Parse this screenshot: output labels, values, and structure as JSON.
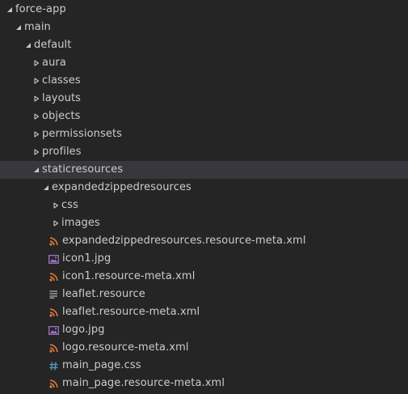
{
  "explorer": {
    "items": [
      {
        "name": "root-folder-force-app",
        "label": "force-app",
        "type": "folder",
        "expanded": true,
        "depth": 0
      },
      {
        "name": "folder-main",
        "label": "main",
        "type": "folder",
        "expanded": true,
        "depth": 1
      },
      {
        "name": "folder-default",
        "label": "default",
        "type": "folder",
        "expanded": true,
        "depth": 2
      },
      {
        "name": "folder-aura",
        "label": "aura",
        "type": "folder",
        "expanded": false,
        "depth": 3
      },
      {
        "name": "folder-classes",
        "label": "classes",
        "type": "folder",
        "expanded": false,
        "depth": 3
      },
      {
        "name": "folder-layouts",
        "label": "layouts",
        "type": "folder",
        "expanded": false,
        "depth": 3
      },
      {
        "name": "folder-objects",
        "label": "objects",
        "type": "folder",
        "expanded": false,
        "depth": 3
      },
      {
        "name": "folder-permissionsets",
        "label": "permissionsets",
        "type": "folder",
        "expanded": false,
        "depth": 3
      },
      {
        "name": "folder-profiles",
        "label": "profiles",
        "type": "folder",
        "expanded": false,
        "depth": 3
      },
      {
        "name": "folder-staticresources",
        "label": "staticresources",
        "type": "folder",
        "expanded": true,
        "depth": 3,
        "selected": true
      },
      {
        "name": "folder-expandedzippedresources",
        "label": "expandedzippedresources",
        "type": "folder",
        "expanded": true,
        "depth": 4
      },
      {
        "name": "folder-css",
        "label": "css",
        "type": "folder",
        "expanded": false,
        "depth": 5
      },
      {
        "name": "folder-images",
        "label": "images",
        "type": "folder",
        "expanded": false,
        "depth": 5
      },
      {
        "name": "file-expandedzippedresources-meta",
        "label": "expandedzippedresources.resource-meta.xml",
        "type": "xml",
        "depth": 4
      },
      {
        "name": "file-icon1-jpg",
        "label": "icon1.jpg",
        "type": "image",
        "depth": 4
      },
      {
        "name": "file-icon1-meta",
        "label": "icon1.resource-meta.xml",
        "type": "xml",
        "depth": 4
      },
      {
        "name": "file-leaflet-resource",
        "label": "leaflet.resource",
        "type": "text",
        "depth": 4
      },
      {
        "name": "file-leaflet-meta",
        "label": "leaflet.resource-meta.xml",
        "type": "xml",
        "depth": 4
      },
      {
        "name": "file-logo-jpg",
        "label": "logo.jpg",
        "type": "image",
        "depth": 4
      },
      {
        "name": "file-logo-meta",
        "label": "logo.resource-meta.xml",
        "type": "xml",
        "depth": 4
      },
      {
        "name": "file-main-page-css",
        "label": "main_page.css",
        "type": "css",
        "depth": 4
      },
      {
        "name": "file-main-page-meta",
        "label": "main_page.resource-meta.xml",
        "type": "xml",
        "depth": 4
      }
    ]
  },
  "icons": {
    "folder": "chevron-icon",
    "xml": "rss-icon",
    "image": "image-icon",
    "text": "lines-icon",
    "css": "hash-icon"
  },
  "colors": {
    "background": "#252526",
    "selected_row": "#37373d",
    "text": "#cccccc",
    "twisty": "#c5c5c5",
    "xml_icon": "#e37933",
    "image_icon": "#a074c4",
    "css_icon": "#519aba",
    "text_icon": "#b9b9b9"
  }
}
